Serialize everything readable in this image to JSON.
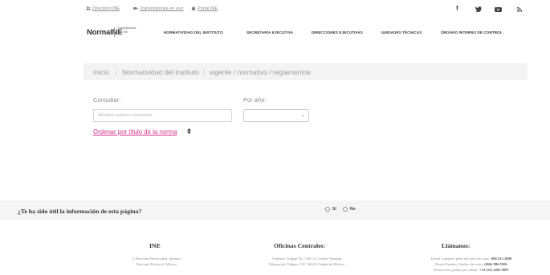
{
  "utility_bar": {
    "links": [
      {
        "label": "Directorio INE",
        "icon": "users-icon"
      },
      {
        "label": "Transmisiones en vivo",
        "icon": "video-icon"
      },
      {
        "label": "Portal INE",
        "icon": "home-icon"
      }
    ],
    "social": [
      {
        "name": "facebook-icon",
        "glyph": "f"
      },
      {
        "name": "twitter-icon",
        "glyph": "♥"
      },
      {
        "name": "youtube-icon",
        "glyph": "▶"
      },
      {
        "name": "rss-icon",
        "glyph": "ℛ"
      }
    ]
  },
  "header": {
    "logo_text": "NormaINE",
    "logo_subtitle": "Normatividad del INE",
    "nav": [
      "NORMATIVIDAD DEL INSTITUTO",
      "SECRETARÍA EJECUTIVA",
      "DIRECCIONES EJECUTIVAS",
      "UNIDADES TÉCNICAS",
      "ÓRGANO INTERNO DE CONTROL"
    ]
  },
  "breadcrumb": {
    "items": [
      "Inicio",
      "Normatividad del Instituto",
      "vigente / normativo / reglamentos"
    ],
    "separator": "/"
  },
  "search": {
    "consultar_label": "Consultar:",
    "placeholder": "Introducir palabra o enunciado",
    "year_label": "Por año:",
    "year_value": "",
    "sort_link": "Ordenar por título de la norma"
  },
  "feedback": {
    "question": "¿Te ha sido útil la información de esta página?",
    "yes_label": "Sí",
    "no_label": "No"
  },
  "footer": {
    "col1": {
      "title": "INE",
      "lines": [
        "© Derechos Reservados, Instituto",
        "Nacional Electoral, México"
      ]
    },
    "col2": {
      "title": "Oficinas Centrales:",
      "lines": [
        "Viaducto Tlalpan No. 100 Col. Arenal Tepepan,",
        "Delegación Tlalpan, C.P. 14610, Ciudad de México."
      ]
    },
    "col3": {
      "title": "Llámanos:",
      "lines": [
        {
          "text": "Desde cualquier parte del país sin costo: ",
          "bold": "800 433 2000"
        },
        {
          "text": "Desde Estados Unidos sin costo: ",
          "bold": "(866) 986 8306"
        },
        {
          "text": "Desde otros países por cobrar: ",
          "bold": "+52 (55) 5481 9897"
        }
      ]
    }
  },
  "colors": {
    "accent_pink": "#d6338a",
    "breadcrumb_bg": "#f3f3f3",
    "feedback_bg": "#f5f5f5"
  }
}
